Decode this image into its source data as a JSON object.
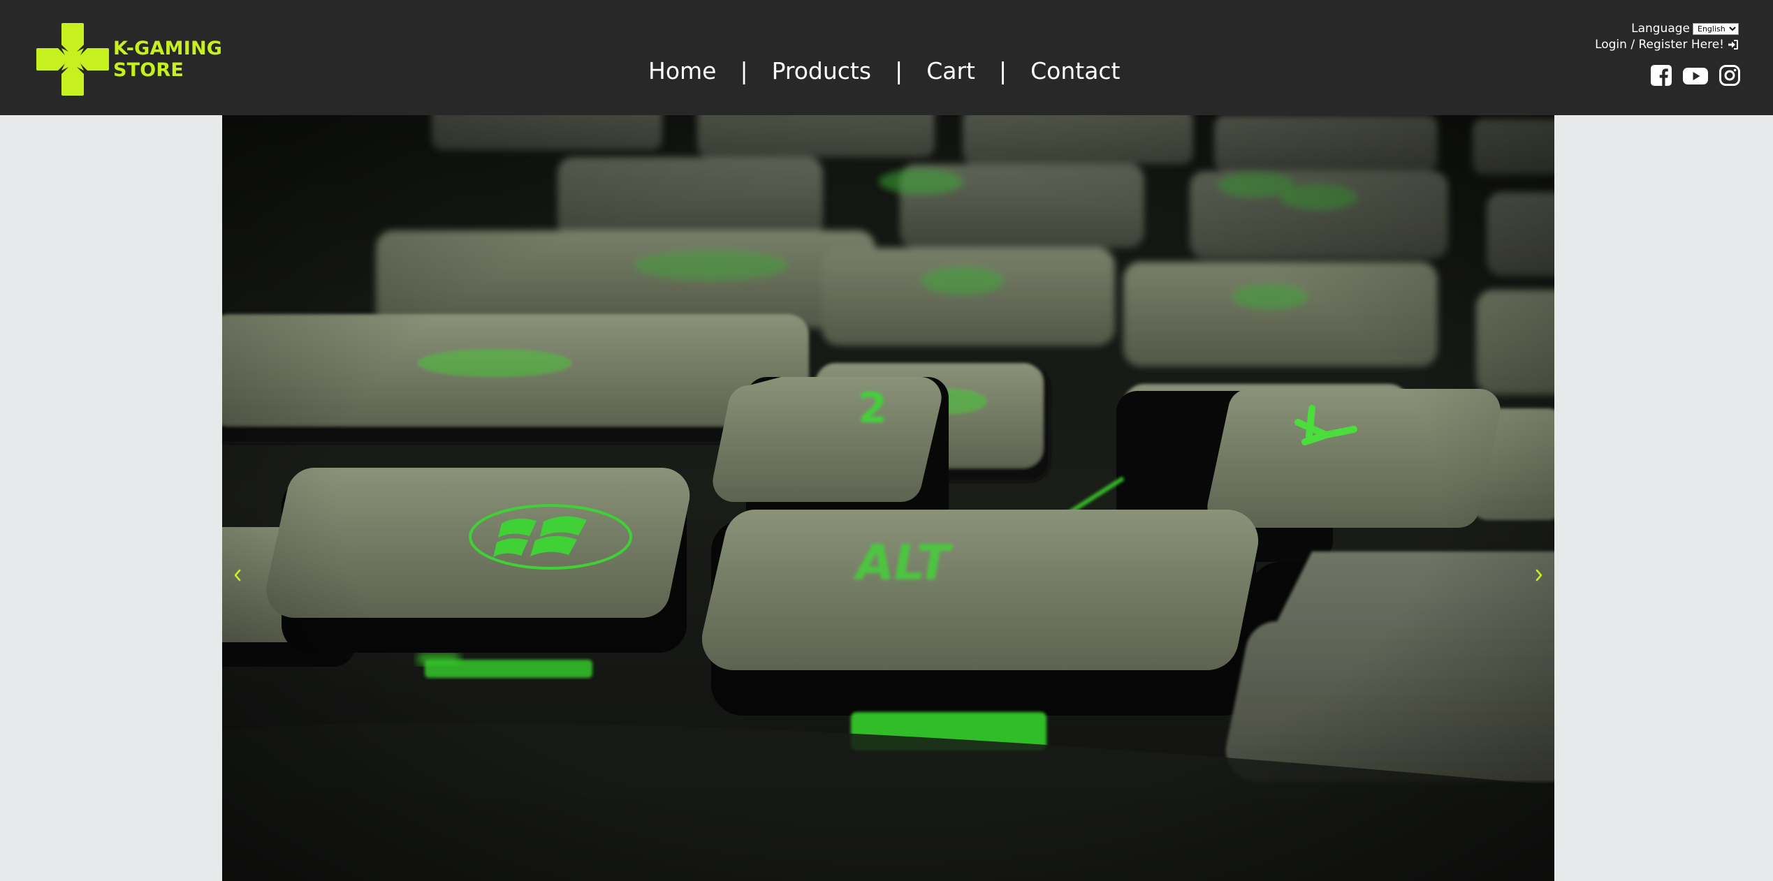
{
  "brand": {
    "line1": "K-GAMING",
    "line2": "STORE",
    "accent_color": "#c6f01e",
    "icon": "plus-cross-logo-icon"
  },
  "nav": {
    "items": [
      {
        "label": "Home"
      },
      {
        "label": "Products"
      },
      {
        "label": "Cart"
      },
      {
        "label": "Contact"
      }
    ],
    "separator": "|"
  },
  "language": {
    "label": "Language",
    "selected": "English"
  },
  "account": {
    "login_text": "Login / Register Here!",
    "icon": "sign-in-icon"
  },
  "social": [
    {
      "icon": "facebook-icon"
    },
    {
      "icon": "youtube-icon"
    },
    {
      "icon": "instagram-icon"
    }
  ],
  "carousel": {
    "prev_icon": "chevron-left-icon",
    "next_icon": "chevron-right-icon",
    "arrow_color": "#c6f01e"
  },
  "colors": {
    "header_bg": "#282828",
    "page_bg": "#e8e9eb",
    "key_glow": "#39d12a"
  }
}
